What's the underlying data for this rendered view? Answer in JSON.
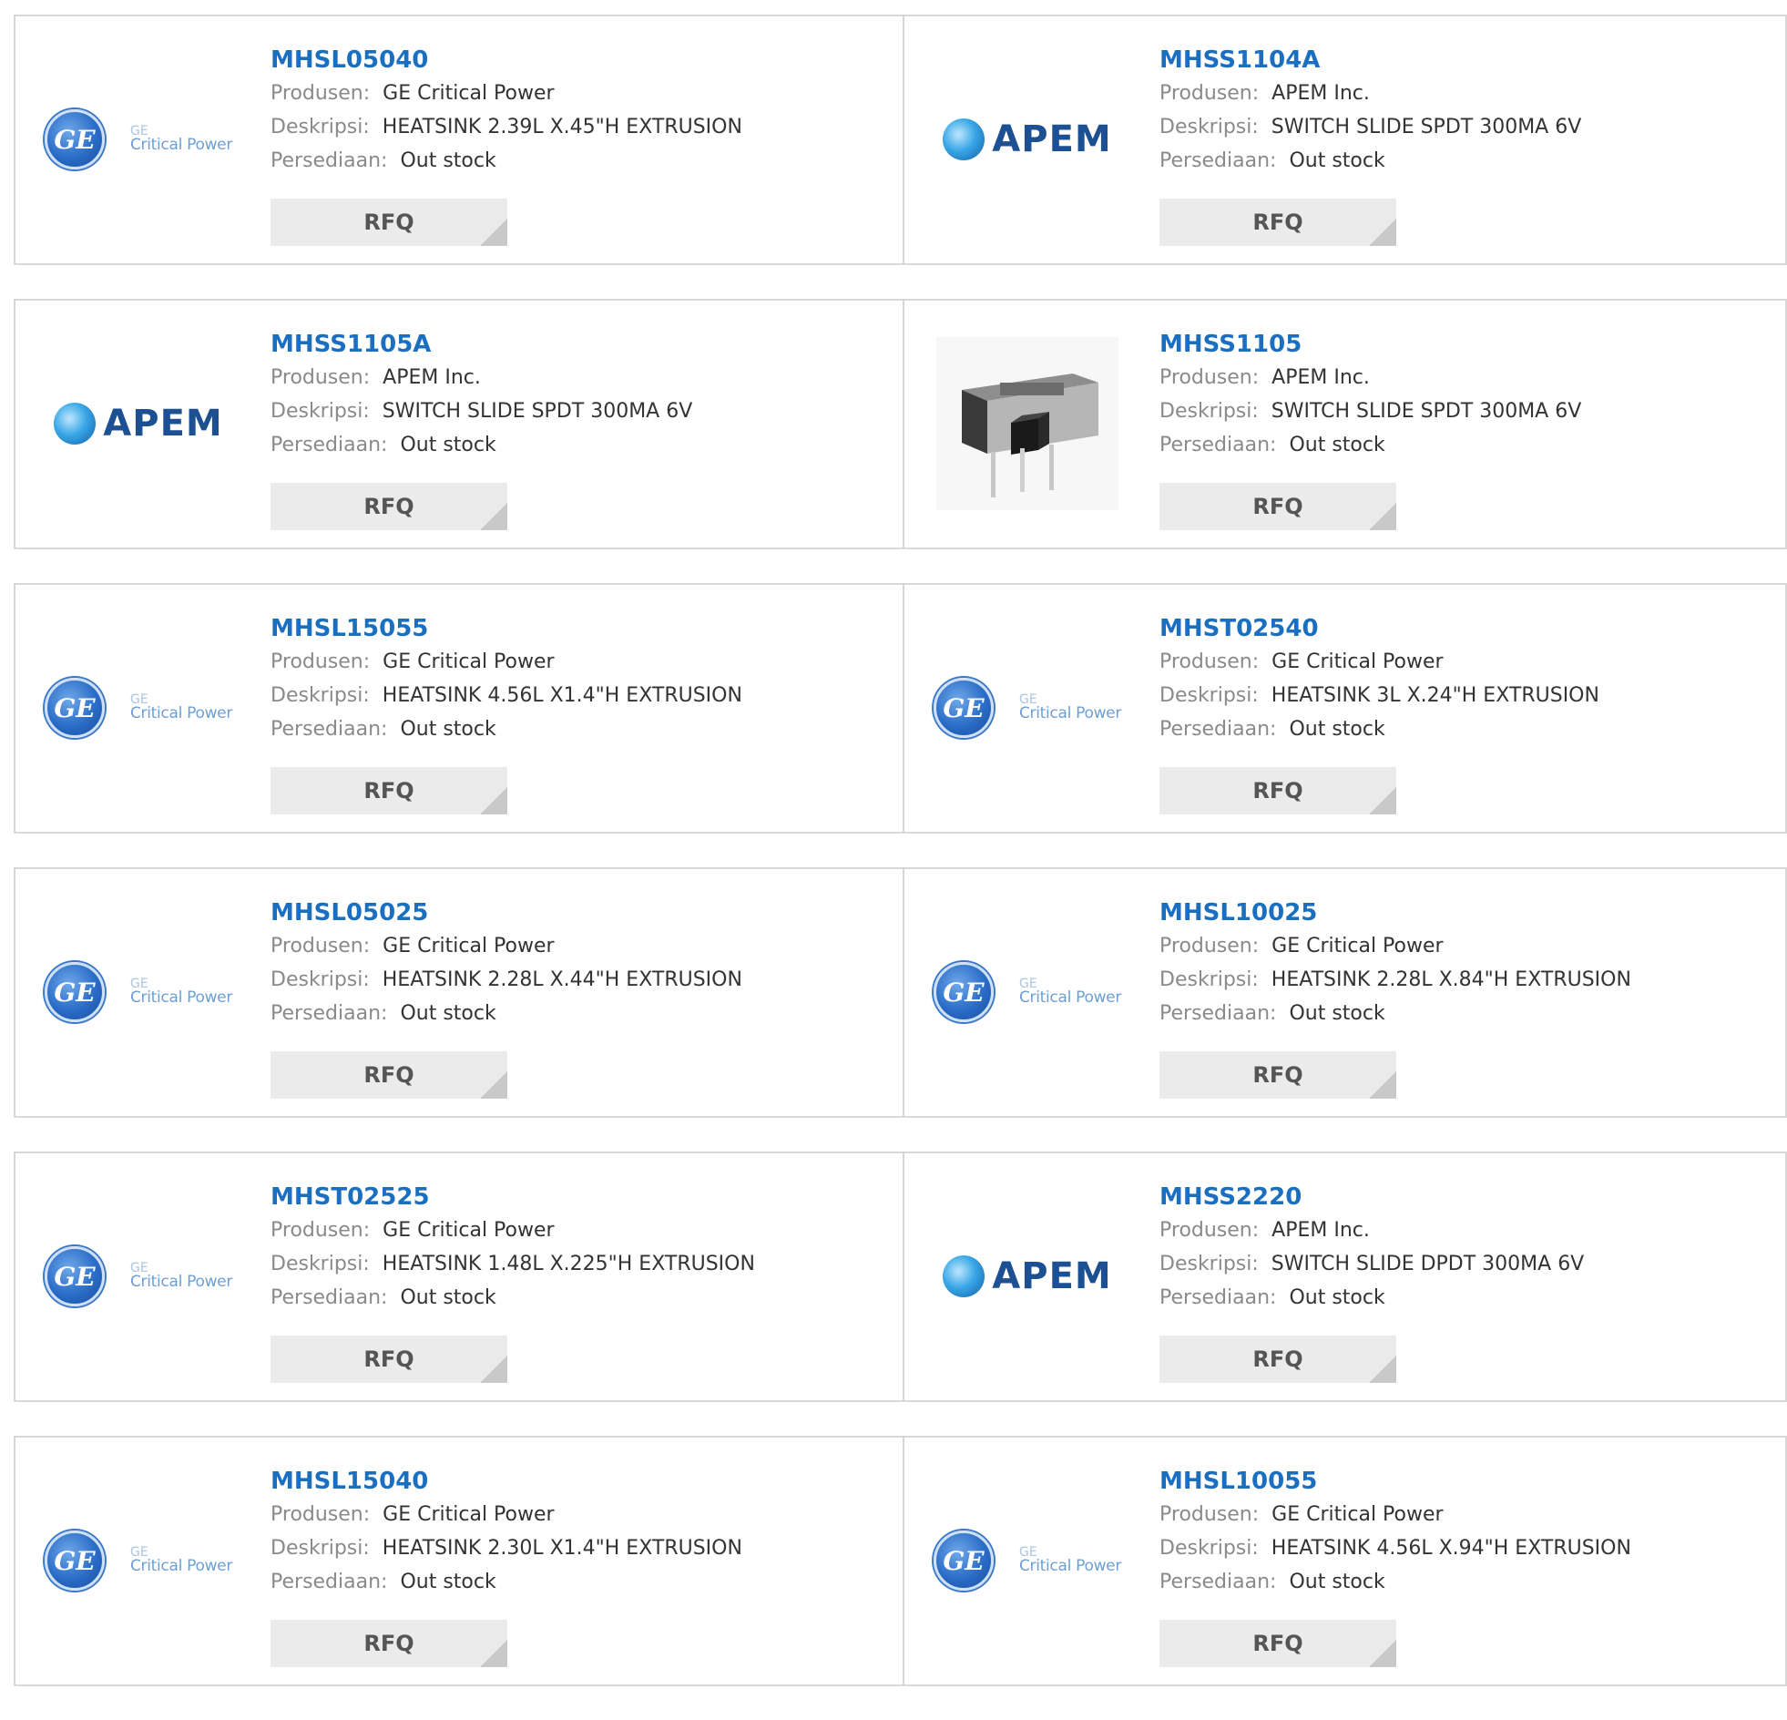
{
  "labels": {
    "manufacturer": "Produsen:",
    "description": "Deskripsi:",
    "stock": "Persediaan:",
    "rfq": "RFQ"
  },
  "logo_text": {
    "ge_small": "GE",
    "ge_big": "Critical Power",
    "ge_mono": "GE",
    "apem": "APEM"
  },
  "products": [
    {
      "part": "MHSL05040",
      "manufacturer": "GE Critical Power",
      "description": "HEATSINK 2.39L X.45\"H EXTRUSION",
      "stock": "Out stock",
      "logo": "ge"
    },
    {
      "part": "MHSS1104A",
      "manufacturer": "APEM Inc.",
      "description": "SWITCH SLIDE SPDT 300MA 6V",
      "stock": "Out stock",
      "logo": "apem"
    },
    {
      "part": "MHSS1105A",
      "manufacturer": "APEM Inc.",
      "description": "SWITCH SLIDE SPDT 300MA 6V",
      "stock": "Out stock",
      "logo": "apem"
    },
    {
      "part": "MHSS1105",
      "manufacturer": "APEM Inc.",
      "description": "SWITCH SLIDE SPDT 300MA 6V",
      "stock": "Out stock",
      "logo": "switch-photo"
    },
    {
      "part": "MHSL15055",
      "manufacturer": "GE Critical Power",
      "description": "HEATSINK 4.56L X1.4\"H EXTRUSION",
      "stock": "Out stock",
      "logo": "ge"
    },
    {
      "part": "MHST02540",
      "manufacturer": "GE Critical Power",
      "description": "HEATSINK 3L X.24\"H EXTRUSION",
      "stock": "Out stock",
      "logo": "ge"
    },
    {
      "part": "MHSL05025",
      "manufacturer": "GE Critical Power",
      "description": "HEATSINK 2.28L X.44\"H EXTRUSION",
      "stock": "Out stock",
      "logo": "ge"
    },
    {
      "part": "MHSL10025",
      "manufacturer": "GE Critical Power",
      "description": "HEATSINK 2.28L X.84\"H EXTRUSION",
      "stock": "Out stock",
      "logo": "ge"
    },
    {
      "part": "MHST02525",
      "manufacturer": "GE Critical Power",
      "description": "HEATSINK 1.48L X.225\"H EXTRUSION",
      "stock": "Out stock",
      "logo": "ge"
    },
    {
      "part": "MHSS2220",
      "manufacturer": "APEM Inc.",
      "description": "SWITCH SLIDE DPDT 300MA 6V",
      "stock": "Out stock",
      "logo": "apem"
    },
    {
      "part": "MHSL15040",
      "manufacturer": "GE Critical Power",
      "description": "HEATSINK 2.30L X1.4\"H EXTRUSION",
      "stock": "Out stock",
      "logo": "ge"
    },
    {
      "part": "MHSL10055",
      "manufacturer": "GE Critical Power",
      "description": "HEATSINK 4.56L X.94\"H EXTRUSION",
      "stock": "Out stock",
      "logo": "ge"
    }
  ]
}
